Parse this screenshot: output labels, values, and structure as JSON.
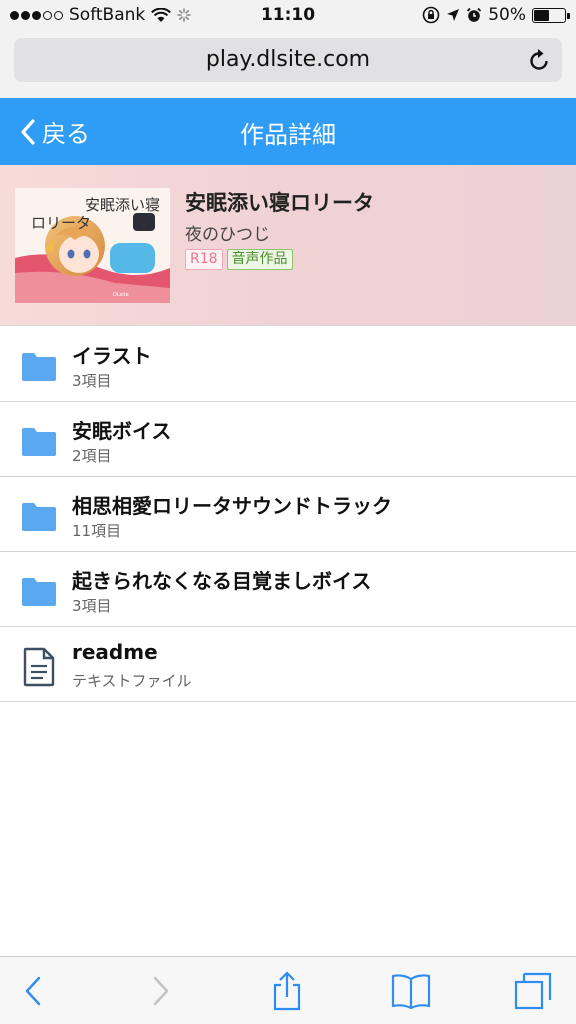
{
  "status_bar": {
    "carrier": "SoftBank",
    "time": "11:10",
    "battery": "50%",
    "battery_level": 0.5
  },
  "browser": {
    "url": "play.dlsite.com"
  },
  "header": {
    "back_label": "戻る",
    "title": "作品詳細"
  },
  "work": {
    "title": "安眠添い寝ロリータ",
    "author": "夜のひつじ",
    "tags": [
      "R18",
      "音声作品"
    ],
    "thumbnail_title_line1": "安眠添い寝",
    "thumbnail_title_line2": "ロリータ"
  },
  "items": [
    {
      "name": "イラスト",
      "sub": "3項目",
      "icon": "folder-icon"
    },
    {
      "name": "安眠ボイス",
      "sub": "2項目",
      "icon": "folder-icon"
    },
    {
      "name": "相思相愛ロリータサウンドトラック",
      "sub": "11項目",
      "icon": "folder-icon"
    },
    {
      "name": "起きられなくなる目覚ましボイス",
      "sub": "3項目",
      "icon": "folder-icon"
    },
    {
      "name": "readme",
      "sub": "テキストファイル",
      "icon": "document-icon"
    }
  ],
  "colors": {
    "accent": "#2f9cf5",
    "folder": "#5aa9f0",
    "document": "#3d4f61",
    "toolbar_icon": "#2f8df2"
  }
}
